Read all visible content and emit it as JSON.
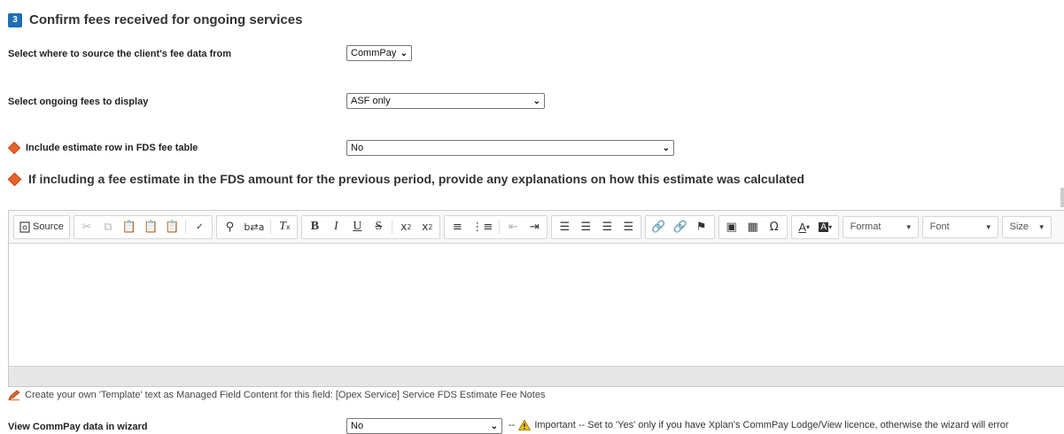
{
  "section": {
    "step_number": "3",
    "title": "Confirm fees received for ongoing services"
  },
  "fields": {
    "source": {
      "label": "Select where to source the client's fee data from",
      "value": "CommPay"
    },
    "ongoing_fees": {
      "label": "Select ongoing fees to display",
      "value": "ASF only"
    },
    "estimate_row": {
      "label": "Include estimate row in FDS fee table",
      "value": "No"
    },
    "view_commpay": {
      "label": "View CommPay data in wizard",
      "value": "No",
      "warning_prefix": "--",
      "warning": "Important -- Set to 'Yes' only if you have Xplan's CommPay Lodge/View licence, otherwise the wizard will error"
    }
  },
  "question": {
    "text": "If including a fee estimate in the FDS amount for the previous period, provide any explanations on how this estimate was calculated"
  },
  "editor": {
    "source_label": "Source",
    "format_label": "Format",
    "font_label": "Font",
    "size_label": "Size",
    "icons": [
      "source-icon",
      "cut-icon",
      "copy-icon",
      "paste-icon",
      "paste-text-icon",
      "paste-word-icon",
      "spellcheck-icon",
      "find-icon",
      "replace-icon",
      "remove-format-icon",
      "bold-icon",
      "italic-icon",
      "underline-icon",
      "strike-icon",
      "subscript-icon",
      "superscript-icon",
      "numbered-list-icon",
      "bulleted-list-icon",
      "outdent-icon",
      "indent-icon",
      "align-left-icon",
      "align-center-icon",
      "align-right-icon",
      "justify-icon",
      "link-icon",
      "unlink-icon",
      "anchor-icon",
      "image-icon",
      "table-icon",
      "special-char-icon",
      "text-color-icon",
      "bg-color-icon"
    ]
  },
  "note": {
    "text": "Create your own 'Template' text as Managed Field Content for this field: [Opex Service] Service FDS Estimate Fee Notes"
  },
  "colors": {
    "badge": "#1e6fb5",
    "diamond": "#e8622a",
    "warning": "#f2c200"
  }
}
